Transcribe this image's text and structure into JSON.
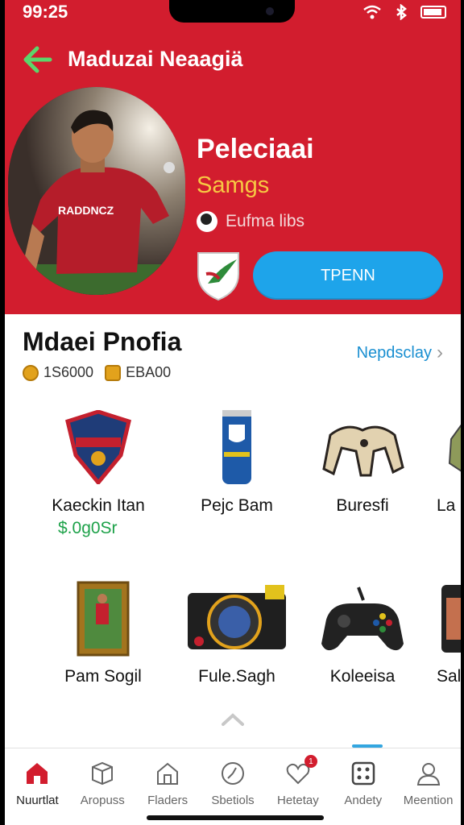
{
  "status": {
    "time": "99:25"
  },
  "header": {
    "title": "Maduzai Neaagiä"
  },
  "player": {
    "name": "Peleciaai",
    "subtitle": "Samgs",
    "meta": "Eufma libs",
    "jersey_text": "RADDNCZ",
    "open_button": "TPENN"
  },
  "section": {
    "title": "Mdaei Pnofia",
    "link": "Nepdsclay",
    "stats": [
      {
        "icon": "coin-icon",
        "value": "1S6000"
      },
      {
        "icon": "coin-icon",
        "value": "EBA00"
      }
    ]
  },
  "items": [
    {
      "name": "Kaeckin Itan",
      "price": "$.0g0Sr",
      "icon": "badge-shield-icon"
    },
    {
      "name": "Pejc Bam",
      "icon": "can-icon"
    },
    {
      "name": "Buresfi",
      "icon": "controller-stand-icon"
    },
    {
      "name": "La",
      "icon": "partial-item-icon"
    },
    {
      "name": "Pam Sogil",
      "icon": "framed-photo-icon"
    },
    {
      "name": "Fule.Sagh",
      "icon": "camera-icon"
    },
    {
      "name": "Koleeisa",
      "icon": "gamepad-icon"
    },
    {
      "name": "Sal",
      "icon": "phone-icon"
    }
  ],
  "tabs": [
    {
      "label": "Nuurtlat",
      "icon": "home-icon",
      "active": true
    },
    {
      "label": "Aropuss",
      "icon": "box-icon"
    },
    {
      "label": "Fladers",
      "icon": "house-outline-icon"
    },
    {
      "label": "Sbetiols",
      "icon": "clock-icon"
    },
    {
      "label": "Hetetay",
      "icon": "heart-icon",
      "badge": "1"
    },
    {
      "label": "Andety",
      "icon": "dice-icon"
    },
    {
      "label": "Meention",
      "icon": "user-icon"
    }
  ],
  "colors": {
    "brand": "#d21d2e",
    "accent": "#1ea4ea",
    "price": "#1ea24a",
    "gold": "#f7c843"
  }
}
